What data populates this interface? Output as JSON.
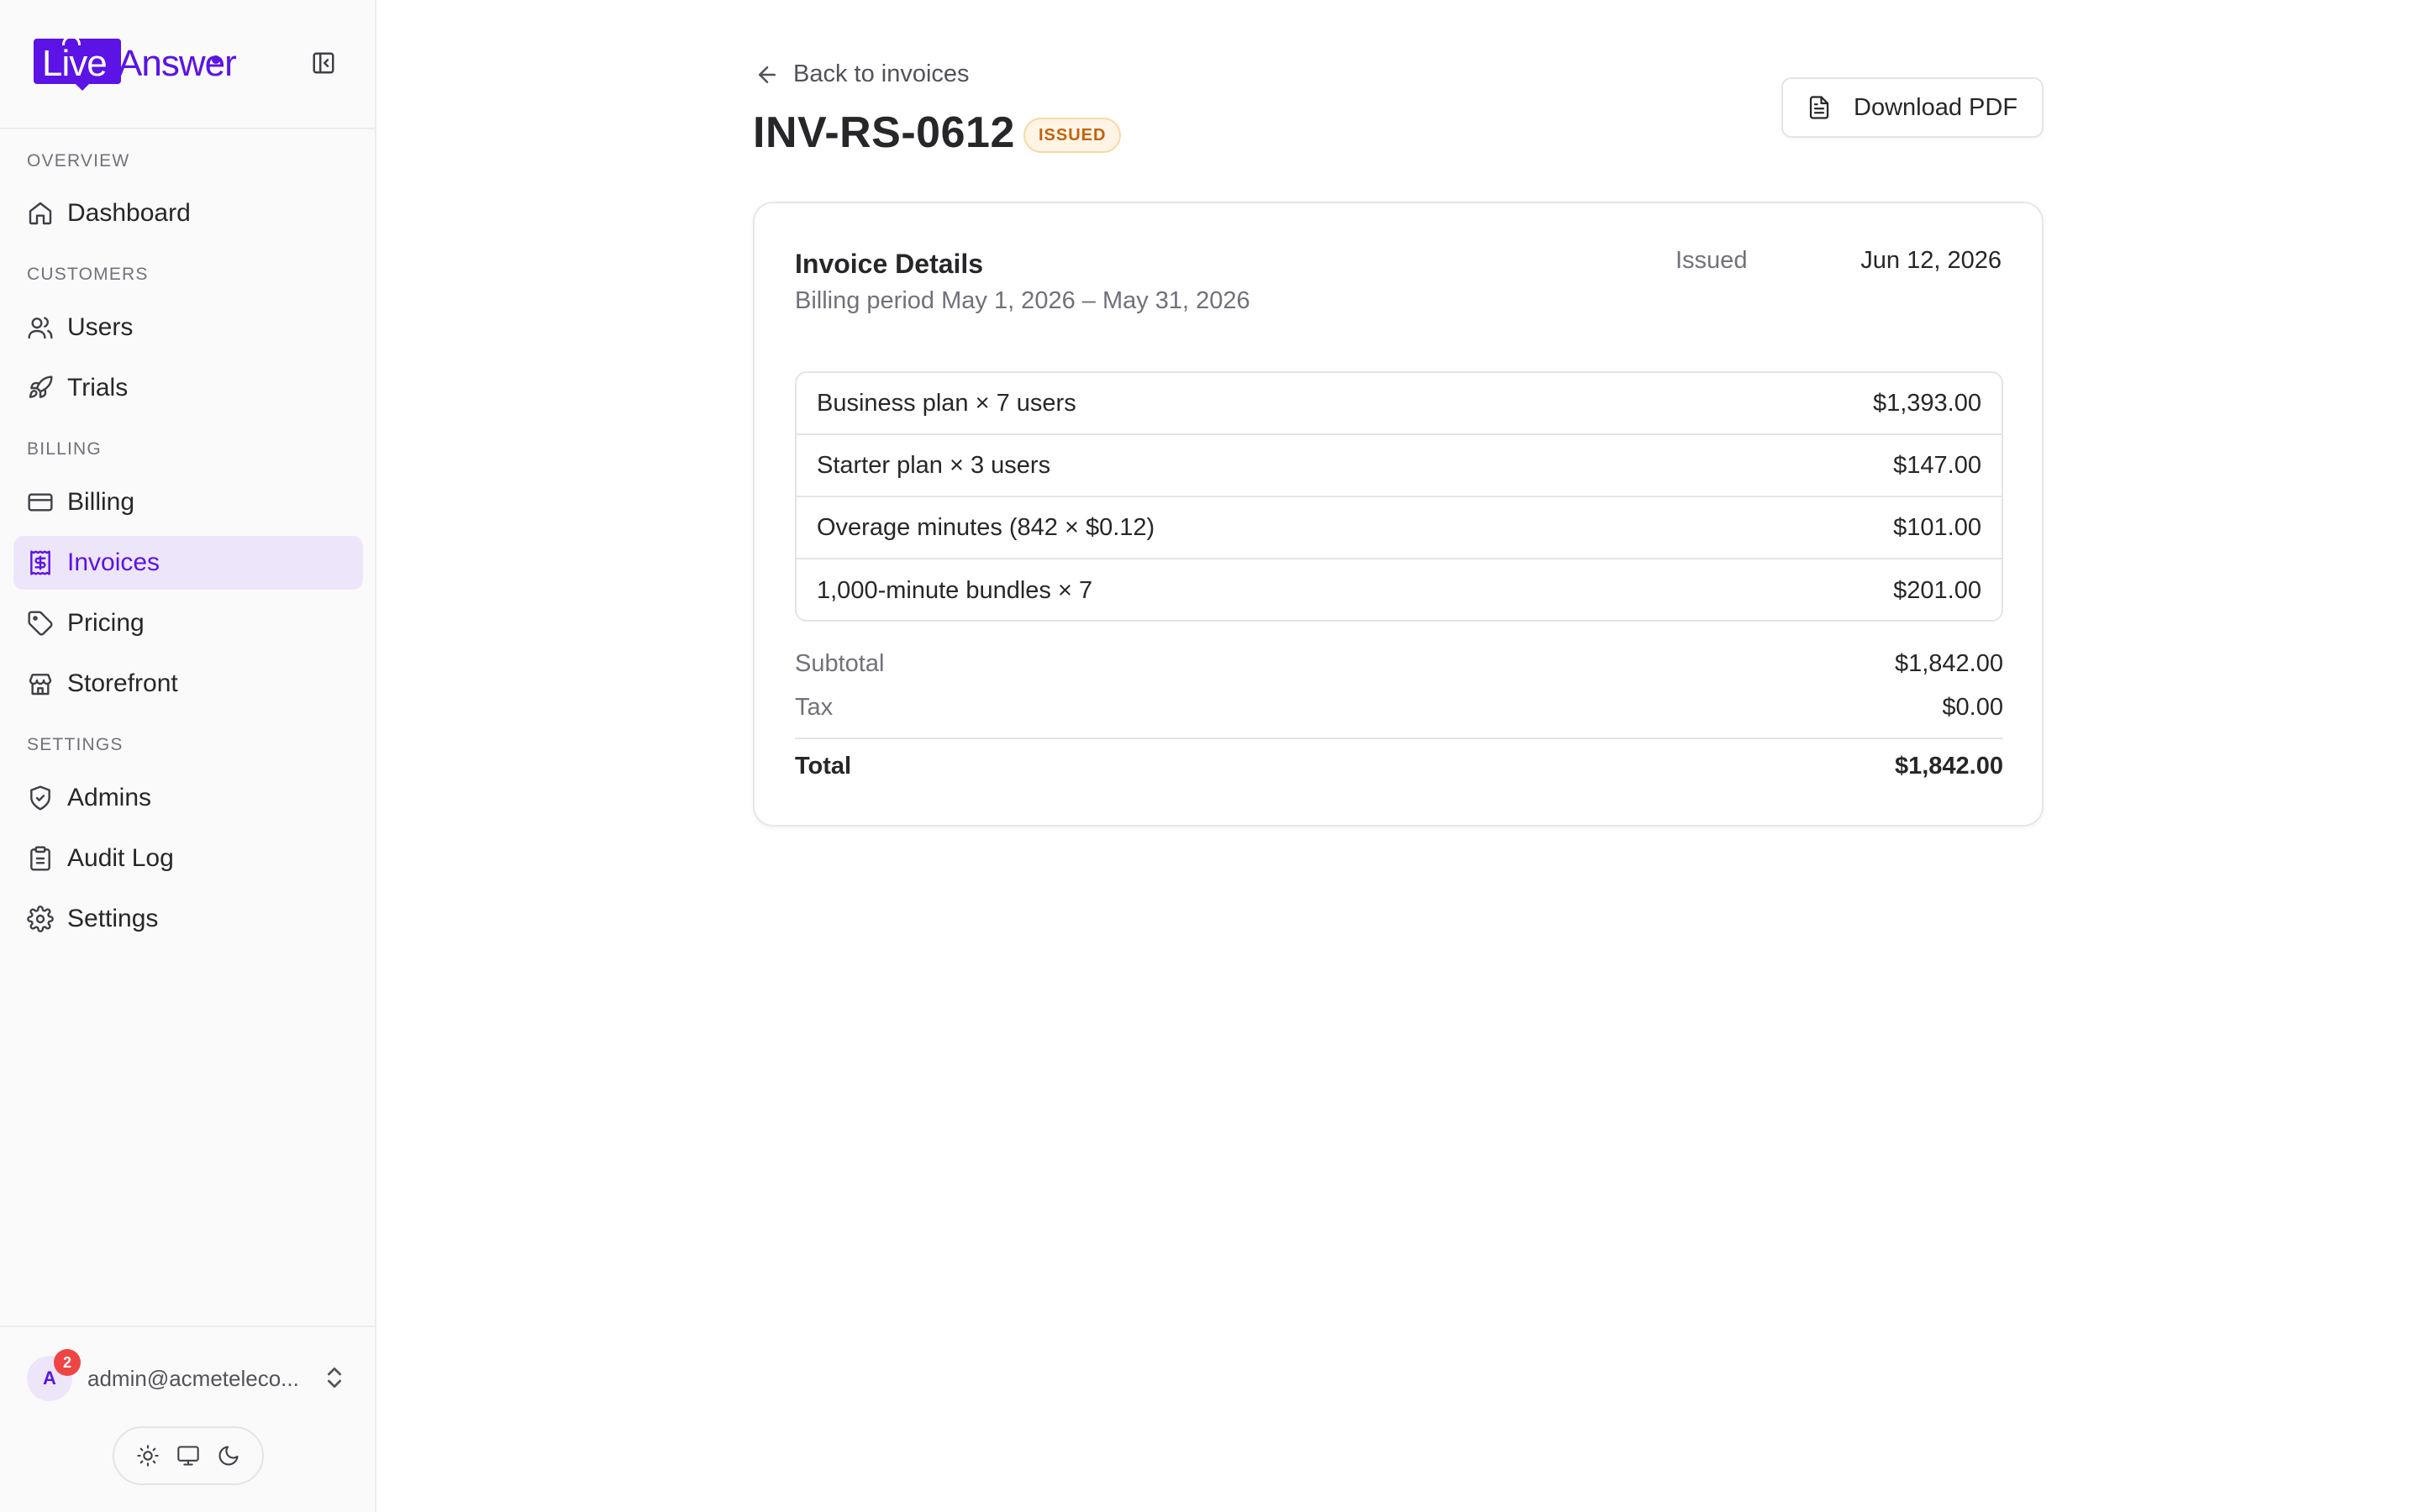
{
  "brand": {
    "logo_live": "Live",
    "logo_answer": "Answer",
    "accent": "#5b13e6"
  },
  "sidebar": {
    "sections": [
      {
        "label": "OVERVIEW"
      },
      {
        "label": "CUSTOMERS"
      },
      {
        "label": "BILLING"
      },
      {
        "label": "SETTINGS"
      }
    ],
    "items": [
      {
        "label": "Dashboard",
        "icon": "home-icon"
      },
      {
        "label": "Users",
        "icon": "users-icon"
      },
      {
        "label": "Trials",
        "icon": "rocket-icon"
      },
      {
        "label": "Billing",
        "icon": "credit-card-icon"
      },
      {
        "label": "Invoices",
        "icon": "invoice-dollar-icon",
        "active": true
      },
      {
        "label": "Pricing",
        "icon": "tag-icon"
      },
      {
        "label": "Storefront",
        "icon": "store-icon"
      },
      {
        "label": "Admins",
        "icon": "shield-check-icon"
      },
      {
        "label": "Audit Log",
        "icon": "clipboard-icon"
      },
      {
        "label": "Settings",
        "icon": "gear-icon"
      }
    ],
    "user": {
      "avatar_initial": "A",
      "notification_count": "2",
      "email": "admin@acmeteleco..."
    },
    "theme_options": [
      "sun-icon",
      "monitor-icon",
      "moon-icon"
    ]
  },
  "header": {
    "back_label": "Back to invoices",
    "invoice_id": "INV-RS-0612",
    "status": "ISSUED",
    "download_label": "Download PDF"
  },
  "invoice": {
    "title": "Invoice Details",
    "billing_period": "Billing period May 1, 2026 – May 31, 2026",
    "issued_label": "Issued",
    "issued_date": "Jun 12, 2026",
    "line_items": [
      {
        "description": "Business plan × 7 users",
        "amount": "$1,393.00"
      },
      {
        "description": "Starter plan × 3 users",
        "amount": "$147.00"
      },
      {
        "description": "Overage minutes (842 × $0.12)",
        "amount": "$101.00"
      },
      {
        "description": "1,000-minute bundles × 7",
        "amount": "$201.00"
      }
    ],
    "subtotal_label": "Subtotal",
    "subtotal": "$1,842.00",
    "tax_label": "Tax",
    "tax": "$0.00",
    "total_label": "Total",
    "total": "$1,842.00"
  }
}
